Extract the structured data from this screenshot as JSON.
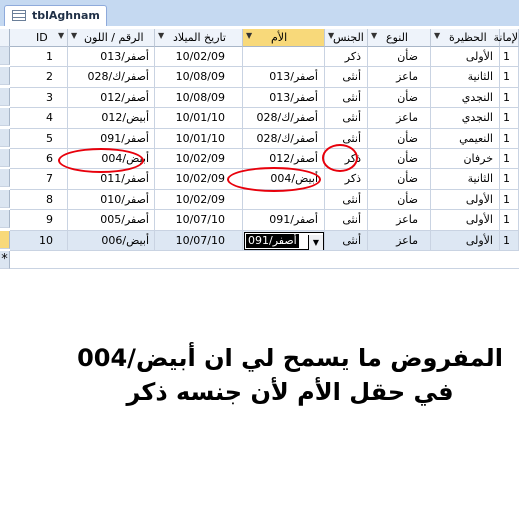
{
  "tab": {
    "title": "tblAghnam",
    "icon": "table-icon"
  },
  "columns": [
    "ID",
    "الرقم / اللون",
    "تاريخ الميلاد",
    "الأم",
    "الجنس",
    "النوع",
    "الحظيرة",
    "لإمانة"
  ],
  "rows": [
    {
      "id": "1",
      "color": "أصفر/013",
      "date": "10/02/09",
      "mother": "",
      "sex": "ذكر",
      "type": "ضأن",
      "barn": "الأولى",
      "last": "1"
    },
    {
      "id": "2",
      "color": "أصفر/ك/028",
      "date": "10/08/09",
      "mother": "أصفر/013",
      "sex": "أنثى",
      "type": "ماعز",
      "barn": "الثانية",
      "last": "1"
    },
    {
      "id": "3",
      "color": "أصفر/012",
      "date": "10/08/09",
      "mother": "أصفر/013",
      "sex": "أنثى",
      "type": "ضأن",
      "barn": "النجدي",
      "last": "1"
    },
    {
      "id": "4",
      "color": "أبيض/012",
      "date": "10/01/10",
      "mother": "أصفر/ك/028",
      "sex": "أنثى",
      "type": "ماعز",
      "barn": "النجدي",
      "last": "1"
    },
    {
      "id": "5",
      "color": "أصفر/091",
      "date": "10/01/10",
      "mother": "أصفر/ك/028",
      "sex": "أنثى",
      "type": "ضأن",
      "barn": "النعيمي",
      "last": "1"
    },
    {
      "id": "6",
      "color": "أبيض/004",
      "date": "10/02/09",
      "mother": "أصفر/012",
      "sex": "ذكر",
      "type": "ضأن",
      "barn": "خرفان",
      "last": "1"
    },
    {
      "id": "7",
      "color": "أصفر/011",
      "date": "10/02/09",
      "mother": "أبيض/004",
      "sex": "ذكر",
      "type": "ضأن",
      "barn": "الثانية",
      "last": "1"
    },
    {
      "id": "8",
      "color": "أصفر/010",
      "date": "10/02/09",
      "mother": "",
      "sex": "أنثى",
      "type": "ضأن",
      "barn": "الأولى",
      "last": "1"
    },
    {
      "id": "9",
      "color": "أصفر/005",
      "date": "10/07/10",
      "mother": "أصفر/091",
      "sex": "أنثى",
      "type": "ماعز",
      "barn": "الأولى",
      "last": "1"
    },
    {
      "id": "10",
      "color": "أبيض/006",
      "date": "10/07/10",
      "mother": "أصفر/091",
      "sex": "أنثى",
      "type": "ماعز",
      "barn": "الأولى",
      "last": "1"
    }
  ],
  "new_row_marker": "*",
  "note_line1": "المفروض ما يسمح لي ان أبيض/004",
  "note_line2": "في حقل الأم لأن جنسه ذكر",
  "dropdown_arrow": "▼",
  "accent_color": "#e8000b"
}
